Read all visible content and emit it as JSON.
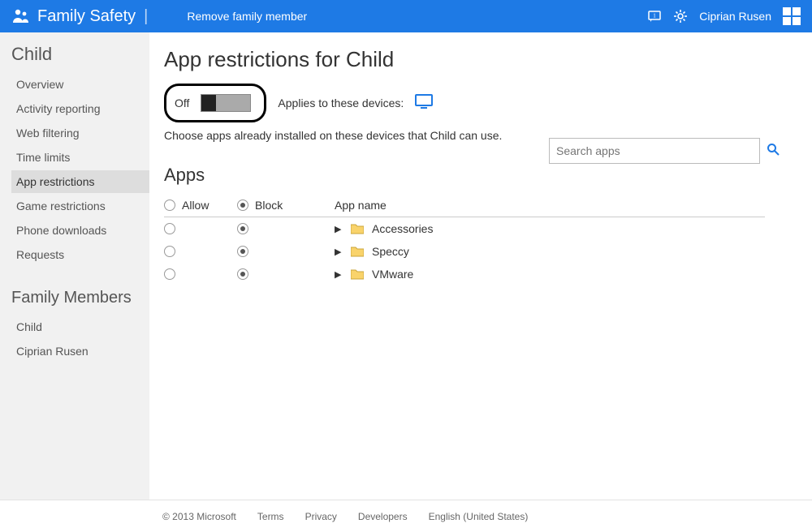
{
  "header": {
    "brand_title": "Family Safety",
    "remove_link": "Remove family member",
    "user_name": "Ciprian Rusen"
  },
  "sidebar": {
    "child_title": "Child",
    "items": [
      {
        "label": "Overview"
      },
      {
        "label": "Activity reporting"
      },
      {
        "label": "Web filtering"
      },
      {
        "label": "Time limits"
      },
      {
        "label": "App restrictions",
        "active": true
      },
      {
        "label": "Game restrictions"
      },
      {
        "label": "Phone downloads"
      },
      {
        "label": "Requests"
      }
    ],
    "family_title": "Family Members",
    "family_members": [
      {
        "label": "Child"
      },
      {
        "label": "Ciprian Rusen"
      }
    ]
  },
  "main": {
    "page_title": "App restrictions for Child",
    "toggle_state_label": "Off",
    "devices_label": "Applies to these devices:",
    "description": "Choose apps already installed on these devices that Child can use.",
    "search_placeholder": "Search apps",
    "apps_title": "Apps",
    "columns": {
      "allow": "Allow",
      "block": "Block",
      "app_name": "App name"
    },
    "apps": [
      {
        "name": "Accessories",
        "state": "block"
      },
      {
        "name": "Speccy",
        "state": "block"
      },
      {
        "name": "VMware",
        "state": "block"
      }
    ]
  },
  "footer": {
    "copyright": "© 2013 Microsoft",
    "links": [
      "Terms",
      "Privacy",
      "Developers",
      "English (United States)"
    ]
  }
}
